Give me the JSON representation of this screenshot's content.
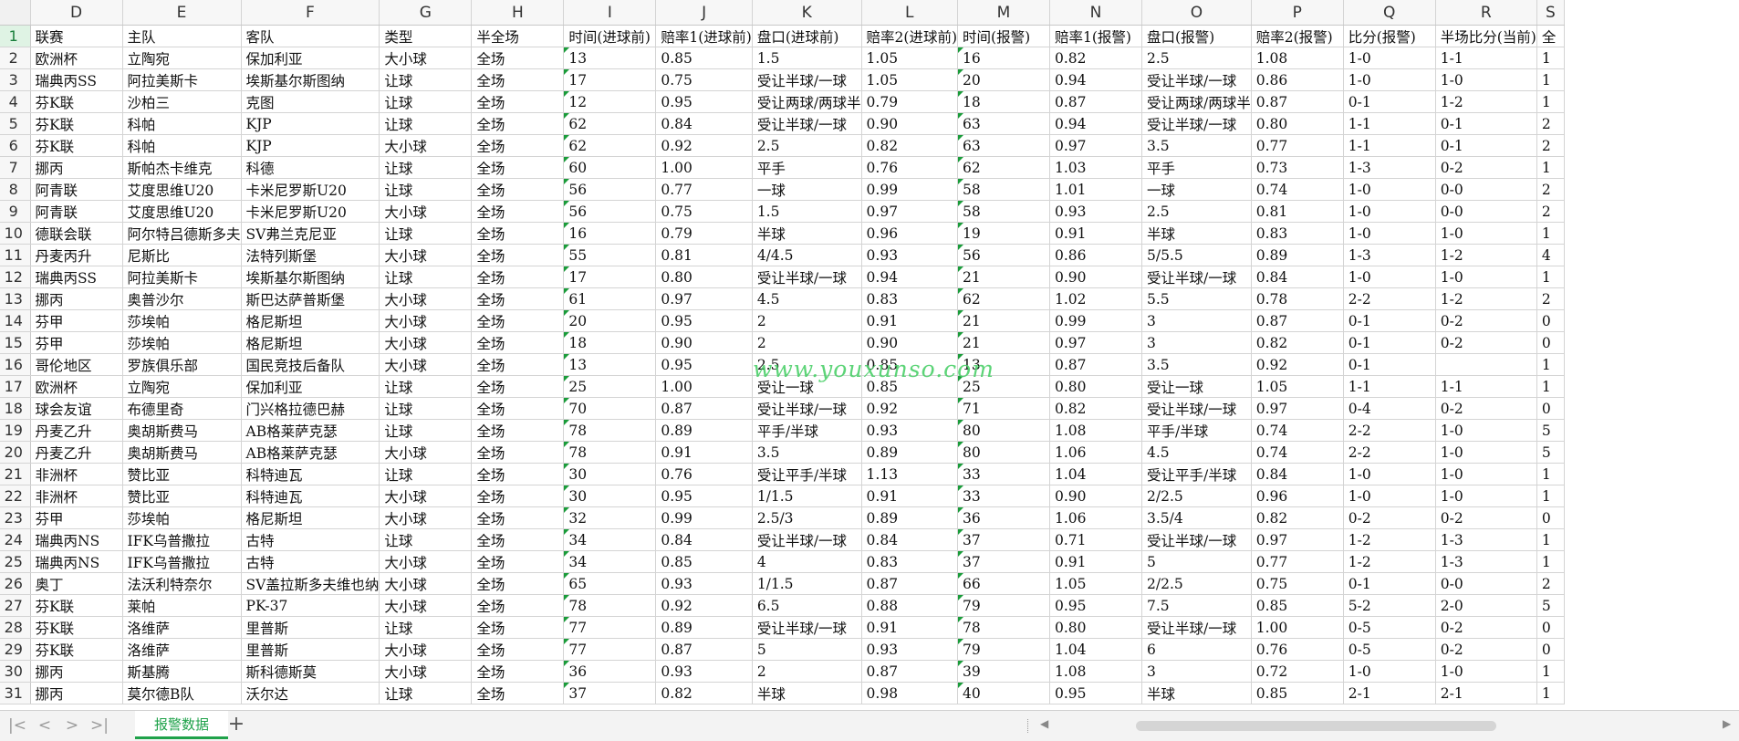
{
  "sheet": {
    "tab_name": "报警数据",
    "add_sheet": "+",
    "nav": {
      "first": "|<",
      "prev": "<",
      "next": ">",
      "last": ">|"
    },
    "scroll_left": "◀",
    "scroll_right": "▶",
    "watermark": "www.youxunso.com",
    "accent_color": "#1fa24a"
  },
  "columns": [
    "D",
    "E",
    "F",
    "G",
    "H",
    "I",
    "J",
    "K",
    "L",
    "M",
    "N",
    "O",
    "P",
    "Q",
    "R",
    "S"
  ],
  "rows": [
    {
      "n": "1",
      "c": [
        "联赛",
        "主队",
        "客队",
        "类型",
        "半全场",
        "时间(进球前)",
        "赔率1(进球前)",
        "盘口(进球前)",
        "赔率2(进球前)",
        "时间(报警)",
        "赔率1(报警)",
        "盘口(报警)",
        "赔率2(报警)",
        "比分(报警)",
        "半场比分(当前)",
        "全"
      ]
    },
    {
      "n": "2",
      "c": [
        "欧洲杯",
        "立陶宛",
        "保加利亚",
        "大小球",
        "全场",
        "13",
        "0.85",
        "1.5",
        "1.05",
        "16",
        "0.82",
        "2.5",
        "1.08",
        "1-0",
        "1-1",
        "1"
      ]
    },
    {
      "n": "3",
      "c": [
        "瑞典丙SS",
        "阿拉美斯卡",
        "埃斯基尔斯图纳",
        "让球",
        "全场",
        "17",
        "0.75",
        "受让半球/一球",
        "1.05",
        "20",
        "0.94",
        "受让半球/一球",
        "0.86",
        "1-0",
        "1-0",
        "1"
      ]
    },
    {
      "n": "4",
      "c": [
        "芬K联",
        "沙柏三",
        "克图",
        "让球",
        "全场",
        "12",
        "0.95",
        "受让两球/两球半",
        "0.79",
        "18",
        "0.87",
        "受让两球/两球半",
        "0.87",
        "0-1",
        "1-2",
        "1"
      ]
    },
    {
      "n": "5",
      "c": [
        "芬K联",
        "科帕",
        "KJP",
        "让球",
        "全场",
        "62",
        "0.84",
        "受让半球/一球",
        "0.90",
        "63",
        "0.94",
        "受让半球/一球",
        "0.80",
        "1-1",
        "0-1",
        "2"
      ]
    },
    {
      "n": "6",
      "c": [
        "芬K联",
        "科帕",
        "KJP",
        "大小球",
        "全场",
        "62",
        "0.92",
        "2.5",
        "0.82",
        "63",
        "0.97",
        "3.5",
        "0.77",
        "1-1",
        "0-1",
        "2"
      ]
    },
    {
      "n": "7",
      "c": [
        "挪丙",
        "斯帕杰卡维克",
        "科德",
        "让球",
        "全场",
        "60",
        "1.00",
        "平手",
        "0.76",
        "62",
        "1.03",
        "平手",
        "0.73",
        "1-3",
        "0-2",
        "1"
      ]
    },
    {
      "n": "8",
      "c": [
        "阿青联",
        "艾度思维U20",
        "卡米尼罗斯U20",
        "让球",
        "全场",
        "56",
        "0.77",
        "一球",
        "0.99",
        "58",
        "1.01",
        "一球",
        "0.74",
        "1-0",
        "0-0",
        "2"
      ]
    },
    {
      "n": "9",
      "c": [
        "阿青联",
        "艾度思维U20",
        "卡米尼罗斯U20",
        "大小球",
        "全场",
        "56",
        "0.75",
        "1.5",
        "0.97",
        "58",
        "0.93",
        "2.5",
        "0.81",
        "1-0",
        "0-0",
        "2"
      ]
    },
    {
      "n": "10",
      "c": [
        "德联会联",
        "阿尔特吕德斯多夫",
        "SV弗兰克尼亚",
        "让球",
        "全场",
        "16",
        "0.79",
        "半球",
        "0.96",
        "19",
        "0.91",
        "半球",
        "0.83",
        "1-0",
        "1-0",
        "1"
      ]
    },
    {
      "n": "11",
      "c": [
        "丹麦丙升",
        "尼斯比",
        "法特列斯堡",
        "大小球",
        "全场",
        "55",
        "0.81",
        "4/4.5",
        "0.93",
        "56",
        "0.86",
        "5/5.5",
        "0.89",
        "1-3",
        "1-2",
        "4"
      ]
    },
    {
      "n": "12",
      "c": [
        "瑞典丙SS",
        "阿拉美斯卡",
        "埃斯基尔斯图纳",
        "让球",
        "全场",
        "17",
        "0.80",
        "受让半球/一球",
        "0.94",
        "21",
        "0.90",
        "受让半球/一球",
        "0.84",
        "1-0",
        "1-0",
        "1"
      ]
    },
    {
      "n": "13",
      "c": [
        "挪丙",
        "奥普沙尔",
        "斯巴达萨普斯堡",
        "大小球",
        "全场",
        "61",
        "0.97",
        "4.5",
        "0.83",
        "62",
        "1.02",
        "5.5",
        "0.78",
        "2-2",
        "1-2",
        "2"
      ]
    },
    {
      "n": "14",
      "c": [
        "芬甲",
        "莎埃帕",
        "格尼斯坦",
        "大小球",
        "全场",
        "20",
        "0.95",
        "2",
        "0.91",
        "21",
        "0.99",
        "3",
        "0.87",
        "0-1",
        "0-2",
        "0"
      ]
    },
    {
      "n": "15",
      "c": [
        "芬甲",
        "莎埃帕",
        "格尼斯坦",
        "大小球",
        "全场",
        "18",
        "0.90",
        "2",
        "0.90",
        "21",
        "0.97",
        "3",
        "0.82",
        "0-1",
        "0-2",
        "0"
      ]
    },
    {
      "n": "16",
      "c": [
        "哥伦地区",
        "罗族俱乐部",
        "国民竞技后备队",
        "大小球",
        "全场",
        "13",
        "0.95",
        "2.5",
        "0.85",
        "13",
        "0.87",
        "3.5",
        "0.92",
        "0-1",
        "",
        "1"
      ]
    },
    {
      "n": "17",
      "c": [
        "欧洲杯",
        "立陶宛",
        "保加利亚",
        "让球",
        "全场",
        "25",
        "1.00",
        "受让一球",
        "0.85",
        "25",
        "0.80",
        "受让一球",
        "1.05",
        "1-1",
        "1-1",
        "1"
      ]
    },
    {
      "n": "18",
      "c": [
        "球会友谊",
        "布德里奇",
        "门兴格拉德巴赫",
        "让球",
        "全场",
        "70",
        "0.87",
        "受让半球/一球",
        "0.92",
        "71",
        "0.82",
        "受让半球/一球",
        "0.97",
        "0-4",
        "0-2",
        "0"
      ]
    },
    {
      "n": "19",
      "c": [
        "丹麦乙升",
        "奥胡斯费马",
        "AB格莱萨克瑟",
        "让球",
        "全场",
        "78",
        "0.89",
        "平手/半球",
        "0.93",
        "80",
        "1.08",
        "平手/半球",
        "0.74",
        "2-2",
        "1-0",
        "5"
      ]
    },
    {
      "n": "20",
      "c": [
        "丹麦乙升",
        "奥胡斯费马",
        "AB格莱萨克瑟",
        "大小球",
        "全场",
        "78",
        "0.91",
        "3.5",
        "0.89",
        "80",
        "1.06",
        "4.5",
        "0.74",
        "2-2",
        "1-0",
        "5"
      ]
    },
    {
      "n": "21",
      "c": [
        "非洲杯",
        "赞比亚",
        "科特迪瓦",
        "让球",
        "全场",
        "30",
        "0.76",
        "受让平手/半球",
        "1.13",
        "33",
        "1.04",
        "受让平手/半球",
        "0.84",
        "1-0",
        "1-0",
        "1"
      ]
    },
    {
      "n": "22",
      "c": [
        "非洲杯",
        "赞比亚",
        "科特迪瓦",
        "大小球",
        "全场",
        "30",
        "0.95",
        "1/1.5",
        "0.91",
        "33",
        "0.90",
        "2/2.5",
        "0.96",
        "1-0",
        "1-0",
        "1"
      ]
    },
    {
      "n": "23",
      "c": [
        "芬甲",
        "莎埃帕",
        "格尼斯坦",
        "大小球",
        "全场",
        "32",
        "0.99",
        "2.5/3",
        "0.89",
        "36",
        "1.06",
        "3.5/4",
        "0.82",
        "0-2",
        "0-2",
        "0"
      ]
    },
    {
      "n": "24",
      "c": [
        "瑞典丙NS",
        "IFK乌普撒拉",
        "古特",
        "让球",
        "全场",
        "34",
        "0.84",
        "受让半球/一球",
        "0.84",
        "37",
        "0.71",
        "受让半球/一球",
        "0.97",
        "1-2",
        "1-3",
        "1"
      ]
    },
    {
      "n": "25",
      "c": [
        "瑞典丙NS",
        "IFK乌普撒拉",
        "古特",
        "大小球",
        "全场",
        "34",
        "0.85",
        "4",
        "0.83",
        "37",
        "0.91",
        "5",
        "0.77",
        "1-2",
        "1-3",
        "1"
      ]
    },
    {
      "n": "26",
      "c": [
        "奥丁",
        "法沃利特奈尔",
        "SV盖拉斯多夫维也纳",
        "大小球",
        "全场",
        "65",
        "0.93",
        "1/1.5",
        "0.87",
        "66",
        "1.05",
        "2/2.5",
        "0.75",
        "0-1",
        "0-0",
        "2"
      ]
    },
    {
      "n": "27",
      "c": [
        "芬K联",
        "莱帕",
        "PK-37",
        "大小球",
        "全场",
        "78",
        "0.92",
        "6.5",
        "0.88",
        "79",
        "0.95",
        "7.5",
        "0.85",
        "5-2",
        "2-0",
        "5"
      ]
    },
    {
      "n": "28",
      "c": [
        "芬K联",
        "洛维萨",
        "里普斯",
        "让球",
        "全场",
        "77",
        "0.89",
        "受让半球/一球",
        "0.91",
        "78",
        "0.80",
        "受让半球/一球",
        "1.00",
        "0-5",
        "0-2",
        "0"
      ]
    },
    {
      "n": "29",
      "c": [
        "芬K联",
        "洛维萨",
        "里普斯",
        "大小球",
        "全场",
        "77",
        "0.87",
        "5",
        "0.93",
        "79",
        "1.04",
        "6",
        "0.76",
        "0-5",
        "0-2",
        "0"
      ]
    },
    {
      "n": "30",
      "c": [
        "挪丙",
        "斯基腾",
        "斯科德斯莫",
        "大小球",
        "全场",
        "36",
        "0.93",
        "2",
        "0.87",
        "39",
        "1.08",
        "3",
        "0.72",
        "1-0",
        "1-0",
        "1"
      ]
    },
    {
      "n": "31",
      "c": [
        "挪丙",
        "莫尔德B队",
        "沃尔达",
        "让球",
        "全场",
        "37",
        "0.82",
        "半球",
        "0.98",
        "40",
        "0.95",
        "半球",
        "0.85",
        "2-1",
        "2-1",
        "1"
      ]
    }
  ]
}
